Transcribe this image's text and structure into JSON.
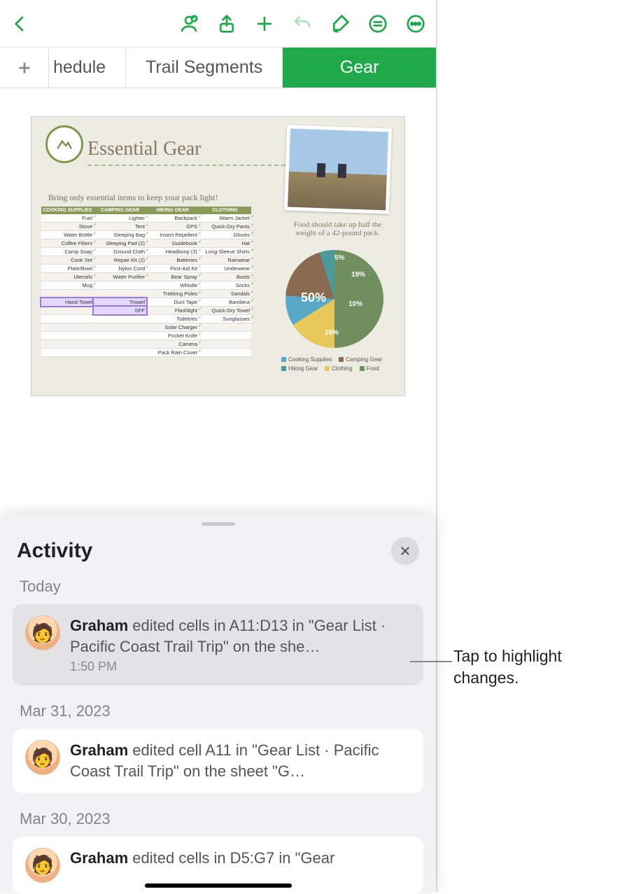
{
  "toolbar": {
    "icons": [
      "back",
      "collaborate",
      "share",
      "add",
      "undo",
      "format",
      "insert",
      "more"
    ]
  },
  "tabs": {
    "partial": "hedule",
    "middle": "Trail Segments",
    "active": "Gear"
  },
  "sheet": {
    "title": "Essential Gear",
    "subtitle": "Bring only essential items to keep your pack light!",
    "photo_caption": "Food should take up half the weight of a 42-pound pack.",
    "table_headers": [
      "COOKING SUPPLIES",
      "CAMPING GEAR",
      "HIKING GEAR",
      "CLOTHING"
    ],
    "table_rows": [
      [
        "Fuel",
        "Lighter",
        "Backpack",
        "Warm Jacket"
      ],
      [
        "Stove",
        "Tent",
        "GPS",
        "Quick-Dry Pants"
      ],
      [
        "Water Bottle",
        "Sleeping Bag",
        "Insect Repellent",
        "Gloves"
      ],
      [
        "Coffee Filters",
        "Sleeping Pad (2)",
        "Guidebook",
        "Hat"
      ],
      [
        "Camp Soap",
        "Ground Cloth",
        "Headlamp (3)",
        "Long-Sleeve Shirts"
      ],
      [
        "Cook Set",
        "Repair Kit (2)",
        "Batteries",
        "Rainwear"
      ],
      [
        "Plate/Bowl",
        "Nylon Cord",
        "First-Aid Kit",
        "Underwear"
      ],
      [
        "Utensils",
        "Water Purifier",
        "Bear Spray",
        "Boots"
      ],
      [
        "Mug",
        "",
        "Whistle",
        "Socks"
      ],
      [
        "",
        "",
        "Trekking Poles",
        "Sandals"
      ],
      [
        "Hand Towel",
        "Trowel",
        "Duct Tape",
        "Bandana"
      ],
      [
        "",
        "SPF",
        "Flashlight",
        "Quick-Dry Towel"
      ],
      [
        "",
        "",
        "Toiletries",
        "Sunglasses"
      ],
      [
        "",
        "",
        "Solar Charger",
        ""
      ],
      [
        "",
        "",
        "Pocket Knife",
        ""
      ],
      [
        "",
        "",
        "Camera",
        ""
      ],
      [
        "",
        "",
        "Pack Rain Cover",
        ""
      ]
    ],
    "highlighted": {
      "rows": [
        10,
        11
      ],
      "cols": [
        0,
        1
      ]
    }
  },
  "chart_data": {
    "type": "pie",
    "title": "",
    "series": [
      {
        "name": "Food",
        "value": 50
      },
      {
        "name": "Camping Gear",
        "value": 19
      },
      {
        "name": "Cooking Supplies",
        "value": 10
      },
      {
        "name": "Clothing",
        "value": 16
      },
      {
        "name": "Hiking Gear",
        "value": 5
      }
    ],
    "labels_shown": [
      "50%",
      "19%",
      "10%",
      "16%",
      "5%"
    ],
    "legend": [
      "Cooking Supplies",
      "Camping Gear",
      "Hiking Gear",
      "Clothing",
      "Food"
    ]
  },
  "activity": {
    "title": "Activity",
    "groups": [
      {
        "label": "Today",
        "items": [
          {
            "user": "Graham",
            "text": " edited cells in A11:D13 in \"Gear List · Pacific Coast Trail Trip\" on the she…",
            "time": "1:50 PM",
            "selected": true
          }
        ]
      },
      {
        "label": "Mar 31, 2023",
        "items": [
          {
            "user": "Graham",
            "text": " edited cell A11 in \"Gear List · Pacific Coast Trail Trip\" on the sheet \"G…",
            "time": "",
            "selected": false
          }
        ]
      },
      {
        "label": "Mar 30, 2023",
        "items": [
          {
            "user": "Graham",
            "text": " edited cells in D5:G7 in \"Gear",
            "time": "",
            "selected": false
          }
        ]
      }
    ]
  },
  "callout": "Tap to highlight changes."
}
